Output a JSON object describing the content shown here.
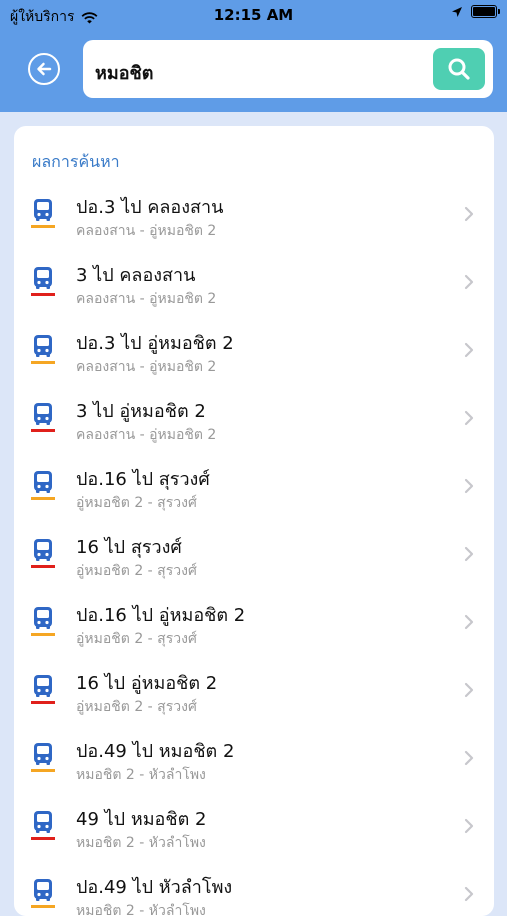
{
  "status_bar": {
    "carrier": "ผู้ให้บริการ",
    "time": "12:15 AM",
    "icons": [
      "wifi-icon",
      "location-arrow-icon",
      "battery-icon"
    ]
  },
  "header": {
    "back_icon": "arrow-left-circle-icon",
    "search": {
      "value": "หมอชิต",
      "button_icon": "search-icon"
    }
  },
  "colors": {
    "header_bg": "#5F9CE7",
    "search_button": "#4FCFB2",
    "section_title": "#3A7BC8",
    "bus_icon": "#2F67C5",
    "line_orange": "#F5A623",
    "line_red": "#E0201B"
  },
  "results": {
    "title": "ผลการค้นหา",
    "items": [
      {
        "title": "ปอ.3 ไป คลองสาน",
        "subtitle": "คลองสาน - อู่หมอชิต 2",
        "line": "orange"
      },
      {
        "title": "3 ไป คลองสาน",
        "subtitle": "คลองสาน - อู่หมอชิต 2",
        "line": "red"
      },
      {
        "title": "ปอ.3 ไป อู่หมอชิต 2",
        "subtitle": "คลองสาน - อู่หมอชิต 2",
        "line": "orange"
      },
      {
        "title": "3 ไป อู่หมอชิต 2",
        "subtitle": "คลองสาน - อู่หมอชิต 2",
        "line": "red"
      },
      {
        "title": "ปอ.16 ไป สุรวงศ์",
        "subtitle": "อู่หมอชิต 2 - สุรวงศ์",
        "line": "orange"
      },
      {
        "title": "16 ไป สุรวงศ์",
        "subtitle": "อู่หมอชิต 2 - สุรวงศ์",
        "line": "red"
      },
      {
        "title": "ปอ.16 ไป อู่หมอชิต 2",
        "subtitle": "อู่หมอชิต 2 - สุรวงศ์",
        "line": "orange"
      },
      {
        "title": "16 ไป อู่หมอชิต 2",
        "subtitle": "อู่หมอชิต 2 - สุรวงศ์",
        "line": "red"
      },
      {
        "title": "ปอ.49 ไป หมอชิต 2",
        "subtitle": "หมอชิต 2 - หัวลำโพง",
        "line": "orange"
      },
      {
        "title": "49 ไป หมอชิต 2",
        "subtitle": "หมอชิต 2 - หัวลำโพง",
        "line": "red"
      },
      {
        "title": "ปอ.49 ไป หัวลำโพง",
        "subtitle": "หมอชิต 2 - หัวลำโพง",
        "line": "orange"
      }
    ]
  }
}
